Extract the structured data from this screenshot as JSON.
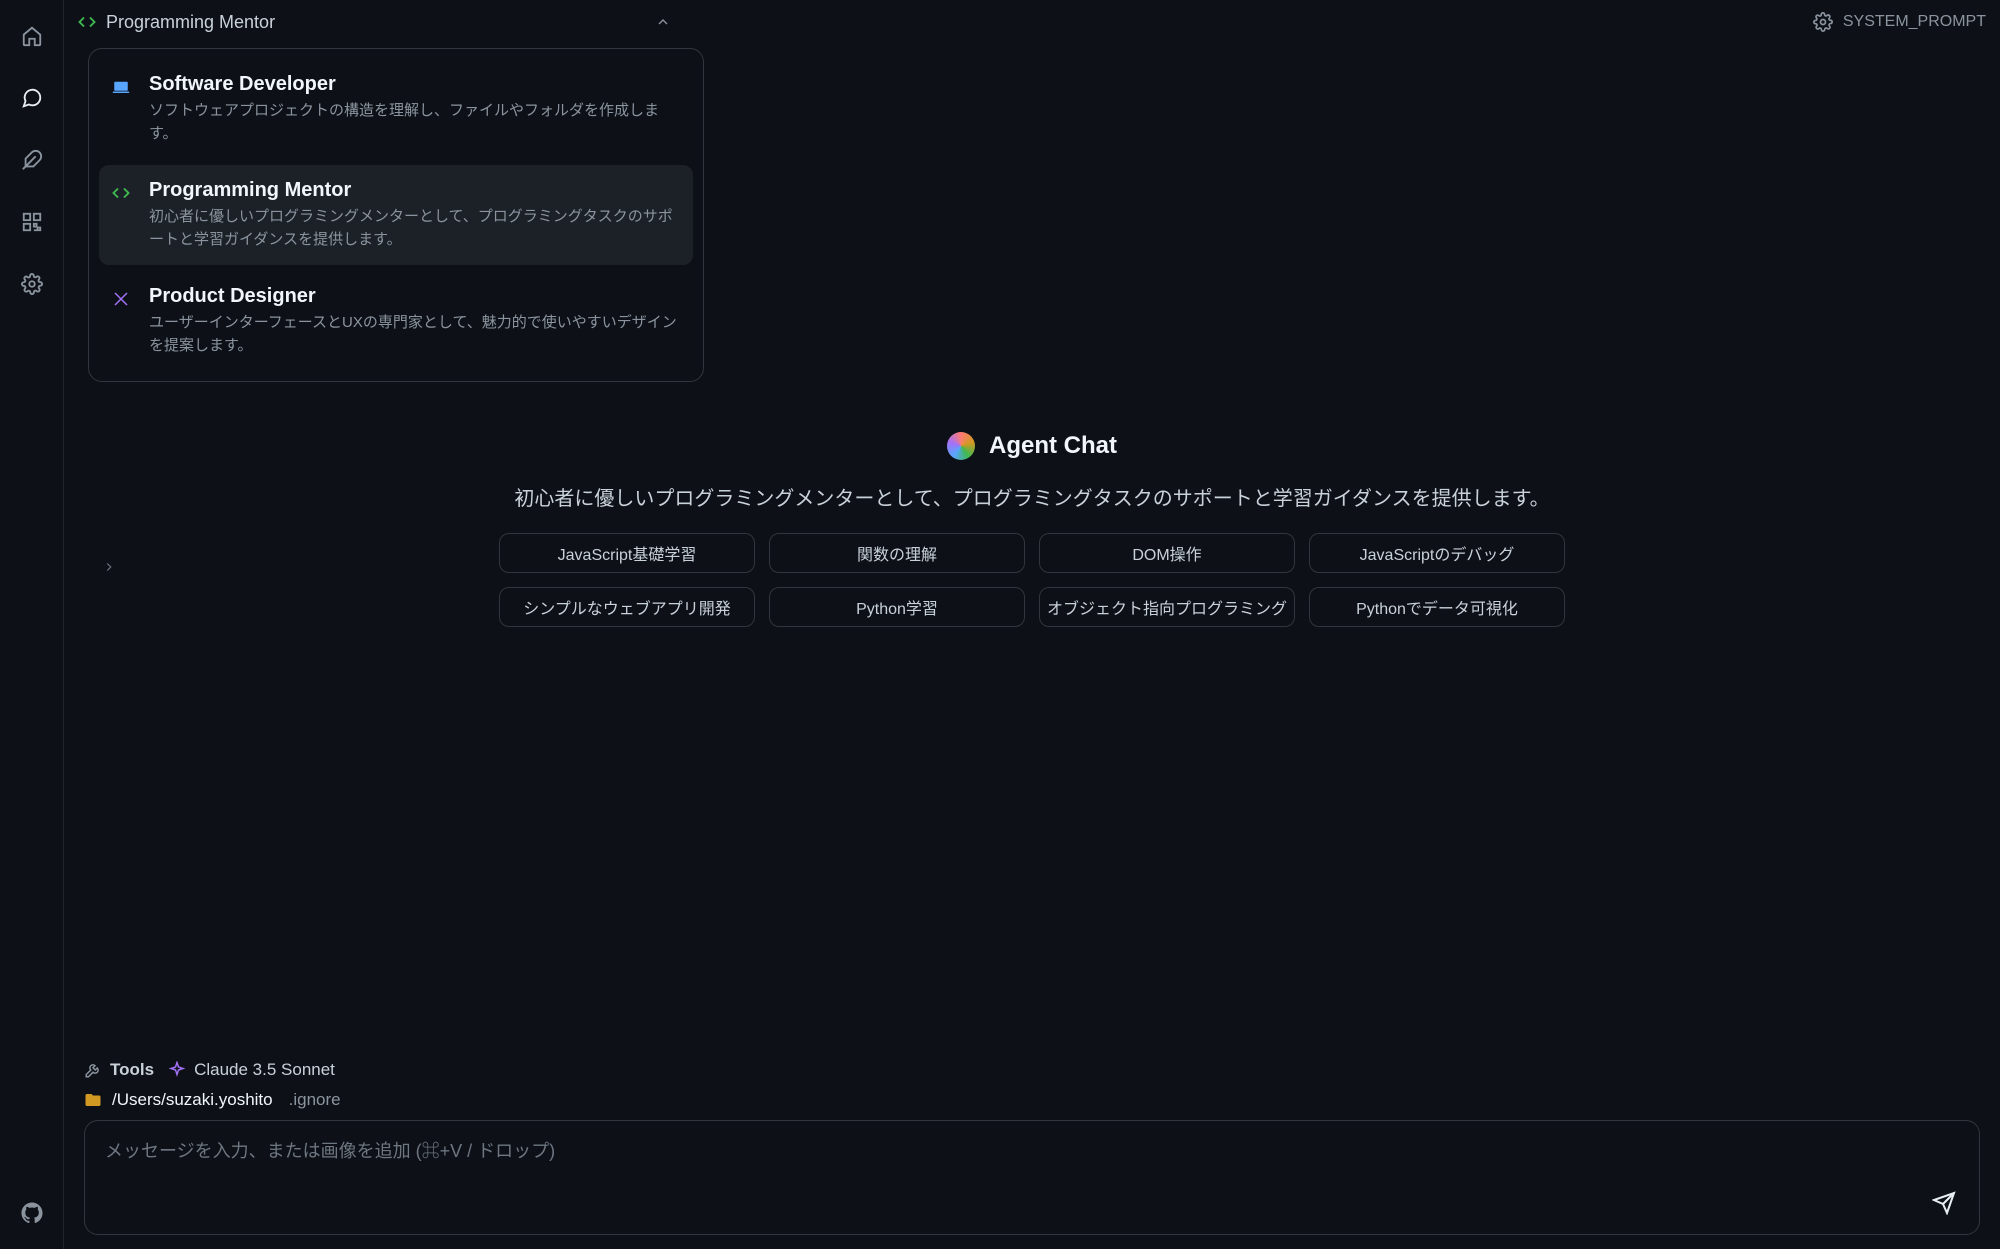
{
  "topbar": {
    "agent_name": "Programming Mentor",
    "system_prompt_label": "SYSTEM_PROMPT"
  },
  "agents": [
    {
      "id": "software-developer",
      "title": "Software Developer",
      "desc": "ソフトウェアプロジェクトの構造を理解し、ファイルやフォルダを作成します。",
      "icon": "laptop-icon",
      "icon_color": "#58a6ff"
    },
    {
      "id": "programming-mentor",
      "title": "Programming Mentor",
      "desc": "初心者に優しいプログラミングメンターとして、プログラミングタスクのサポートと学習ガイダンスを提供します。",
      "icon": "code-icon",
      "icon_color": "#3fb950",
      "selected": true
    },
    {
      "id": "product-designer",
      "title": "Product Designer",
      "desc": "ユーザーインターフェースとUXの専門家として、魅力的で使いやすいデザインを提案します。",
      "icon": "design-icon",
      "icon_color": "#a371f7"
    }
  ],
  "hero": {
    "title": "Agent Chat",
    "subtitle": "初心者に優しいプログラミングメンターとして、プログラミングタスクのサポートと学習ガイダンスを提供します。"
  },
  "suggestions": [
    "JavaScript基礎学習",
    "関数の理解",
    "DOM操作",
    "JavaScriptのデバッグ",
    "シンプルなウェブアプリ開発",
    "Python学習",
    "オブジェクト指向プログラミング",
    "Pythonでデータ可視化"
  ],
  "composer": {
    "tools_label": "Tools",
    "model_label": "Claude 3.5 Sonnet",
    "path": "/Users/suzaki.yoshito",
    "ignore_label": ".ignore",
    "placeholder": "メッセージを入力、または画像を追加 (⌘+V / ドロップ)"
  }
}
